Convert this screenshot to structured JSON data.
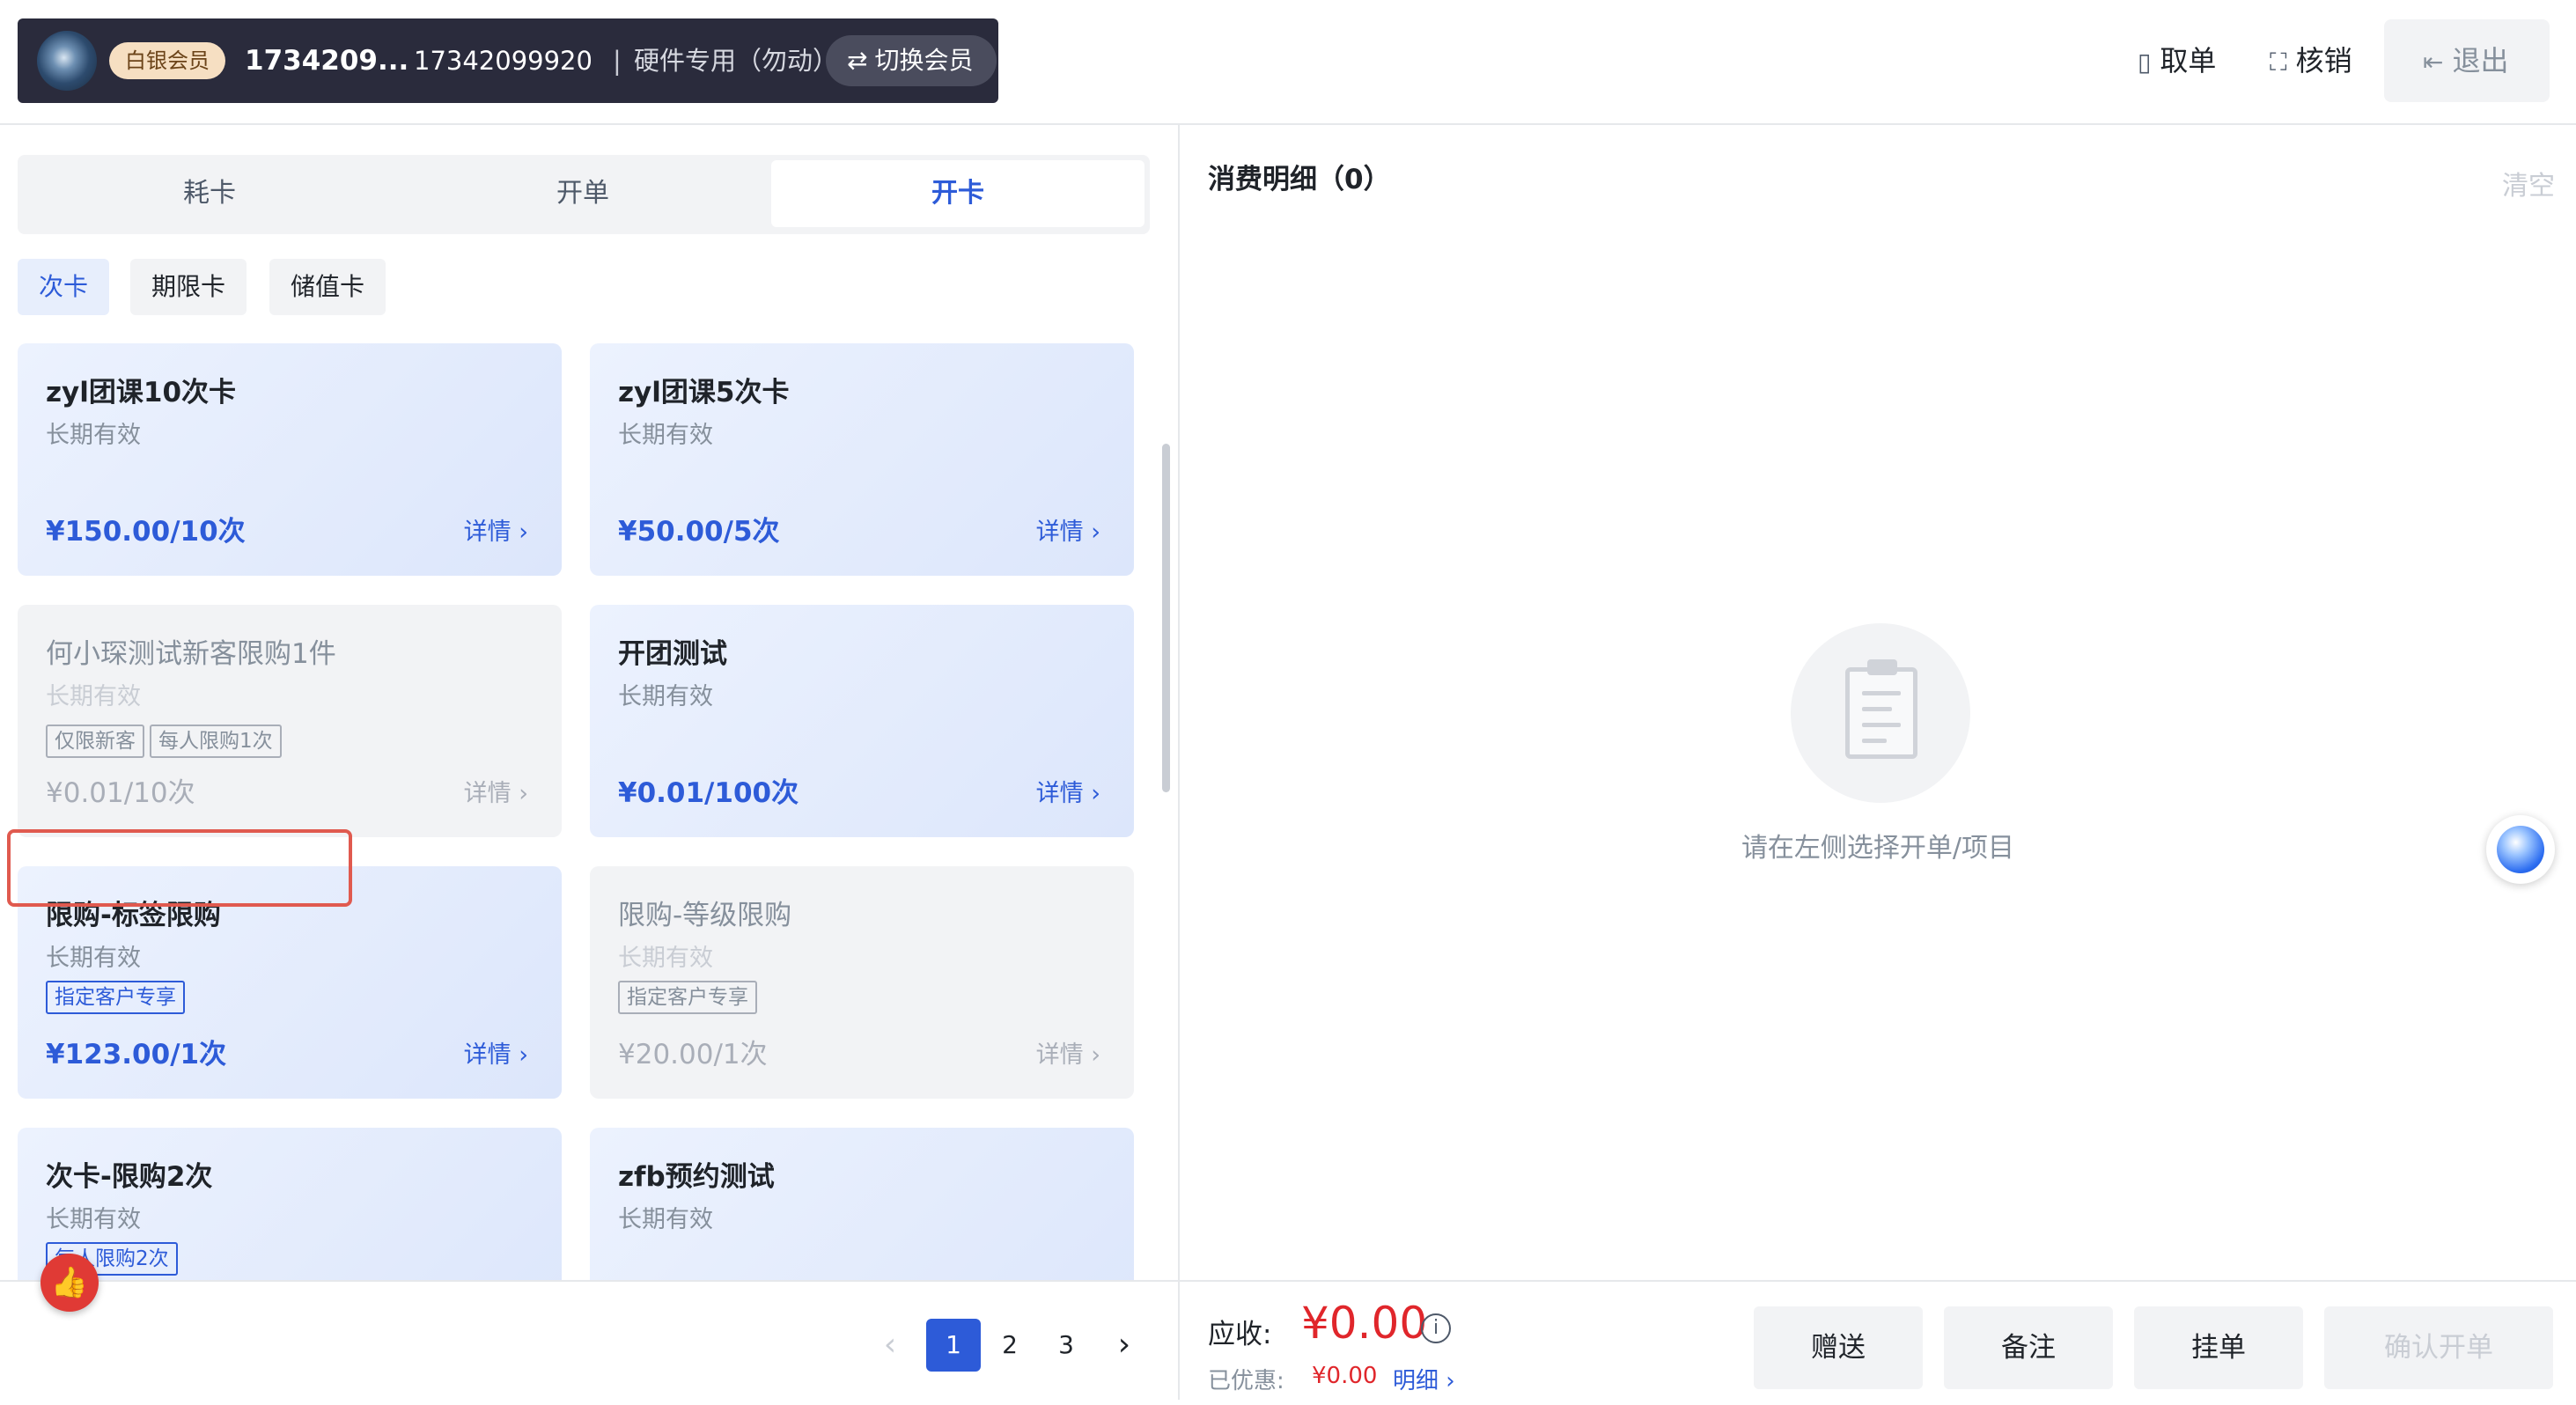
{
  "header": {
    "member": {
      "level": "白银会员",
      "name": "1734209...",
      "phone": "17342099920",
      "separator": "|",
      "note": "硬件专用（勿动）",
      "switch_label": "切换会员"
    },
    "actions": {
      "order_label": "取单",
      "verify_label": "核销",
      "exit_label": "退出"
    }
  },
  "left": {
    "tabs": [
      "耗卡",
      "开单",
      "开卡"
    ],
    "active_tab": "开卡",
    "subtabs": [
      "次卡",
      "期限卡",
      "储值卡"
    ],
    "active_subtab": "次卡",
    "cards": [
      {
        "title": "zyl团课10次卡",
        "validity": "长期有效",
        "tags": [],
        "price": "¥150.00/10次",
        "detail": "详情 ›",
        "disabled": false
      },
      {
        "title": "zyl团课5次卡",
        "validity": "长期有效",
        "tags": [],
        "price": "¥50.00/5次",
        "detail": "详情 ›",
        "disabled": false
      },
      {
        "title": "何小琛测试新客限购1件",
        "validity": "长期有效",
        "tags": [
          "仅限新客",
          "每人限购1次"
        ],
        "price": "¥0.01/10次",
        "detail": "详情 ›",
        "disabled": true
      },
      {
        "title": "开团测试",
        "validity": "长期有效",
        "tags": [],
        "price": "¥0.01/100次",
        "detail": "详情 ›",
        "disabled": false
      },
      {
        "title": "限购-标签限购",
        "validity": "长期有效",
        "tags": [
          "指定客户专享"
        ],
        "price": "¥123.00/1次",
        "detail": "详情 ›",
        "disabled": false
      },
      {
        "title": "限购-等级限购",
        "validity": "长期有效",
        "tags": [
          "指定客户专享"
        ],
        "price": "¥20.00/1次",
        "detail": "详情 ›",
        "disabled": true
      },
      {
        "title": "次卡-限购2次",
        "validity": "长期有效",
        "tags": [
          "每人限购2次"
        ],
        "price": "",
        "detail": "",
        "disabled": false
      },
      {
        "title": "zfb预约测试",
        "validity": "长期有效",
        "tags": [],
        "price": "",
        "detail": "",
        "disabled": false
      }
    ],
    "pagination": {
      "prev": "‹",
      "pages": [
        "1",
        "2",
        "3"
      ],
      "current": "1",
      "next": "›"
    }
  },
  "right": {
    "title": "消费明细（0）",
    "clear_label": "清空",
    "empty_text": "请在左侧选择开单/项目",
    "footer": {
      "due_label": "应收:",
      "due_amount": "¥0.00",
      "info_icon": "i",
      "discount_label": "已优惠:",
      "discount_amount": "¥0.00",
      "discount_detail": "明细 ›",
      "buttons": [
        "赠送",
        "备注",
        "挂单"
      ],
      "confirm_label": "确认开单"
    }
  },
  "colors": {
    "primary": "#2d5bd8",
    "danger": "#e0262b",
    "member_bar": "#2a2b3c",
    "highlight": "#e05a4f"
  },
  "icons": [
    "avatar",
    "switch-icon",
    "receipt-icon",
    "scan-icon",
    "logout-icon",
    "thumbs-up-icon",
    "clipboard-icon",
    "assistant-bubble-icon",
    "info-icon"
  ]
}
